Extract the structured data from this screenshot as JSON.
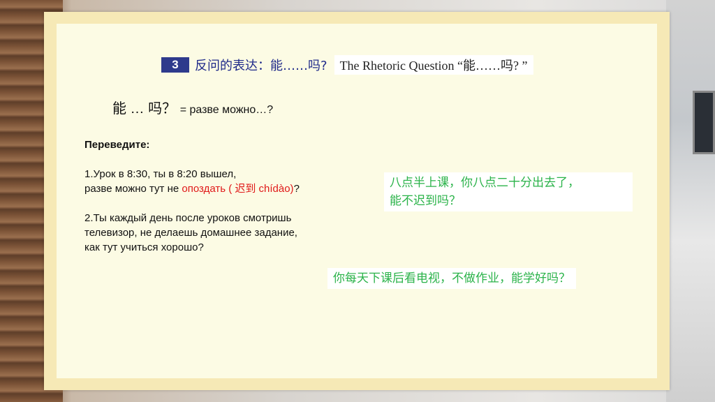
{
  "heading": {
    "number": "3",
    "chinese": "反问的表达：能……吗?",
    "english": "The Rhetoric Question “能……吗? ”"
  },
  "formula": {
    "pattern": "能 … 吗？",
    "russian": "= разве можно…?"
  },
  "task": {
    "title": "Переведите:",
    "q1_line1": "1.Урок в 8:30, ты в 8:20 вышел,",
    "q1_line2_pre": " разве можно тут не ",
    "q1_line2_red": "опоздать ( 迟到 chídào)",
    "q1_line2_post": "?",
    "q2_line1": "2.Ты каждый день после уроков смотришь",
    "q2_line2": "телевизор, не делаешь домашнее задание,",
    "q2_line3": "как тут учиться хорошо?"
  },
  "answers": {
    "a1_line1": "八点半上课，你八点二十分出去了，",
    "a1_line2": "能不迟到吗？",
    "a2": "你每天下课后看电视，不做作业，能学好吗？"
  }
}
